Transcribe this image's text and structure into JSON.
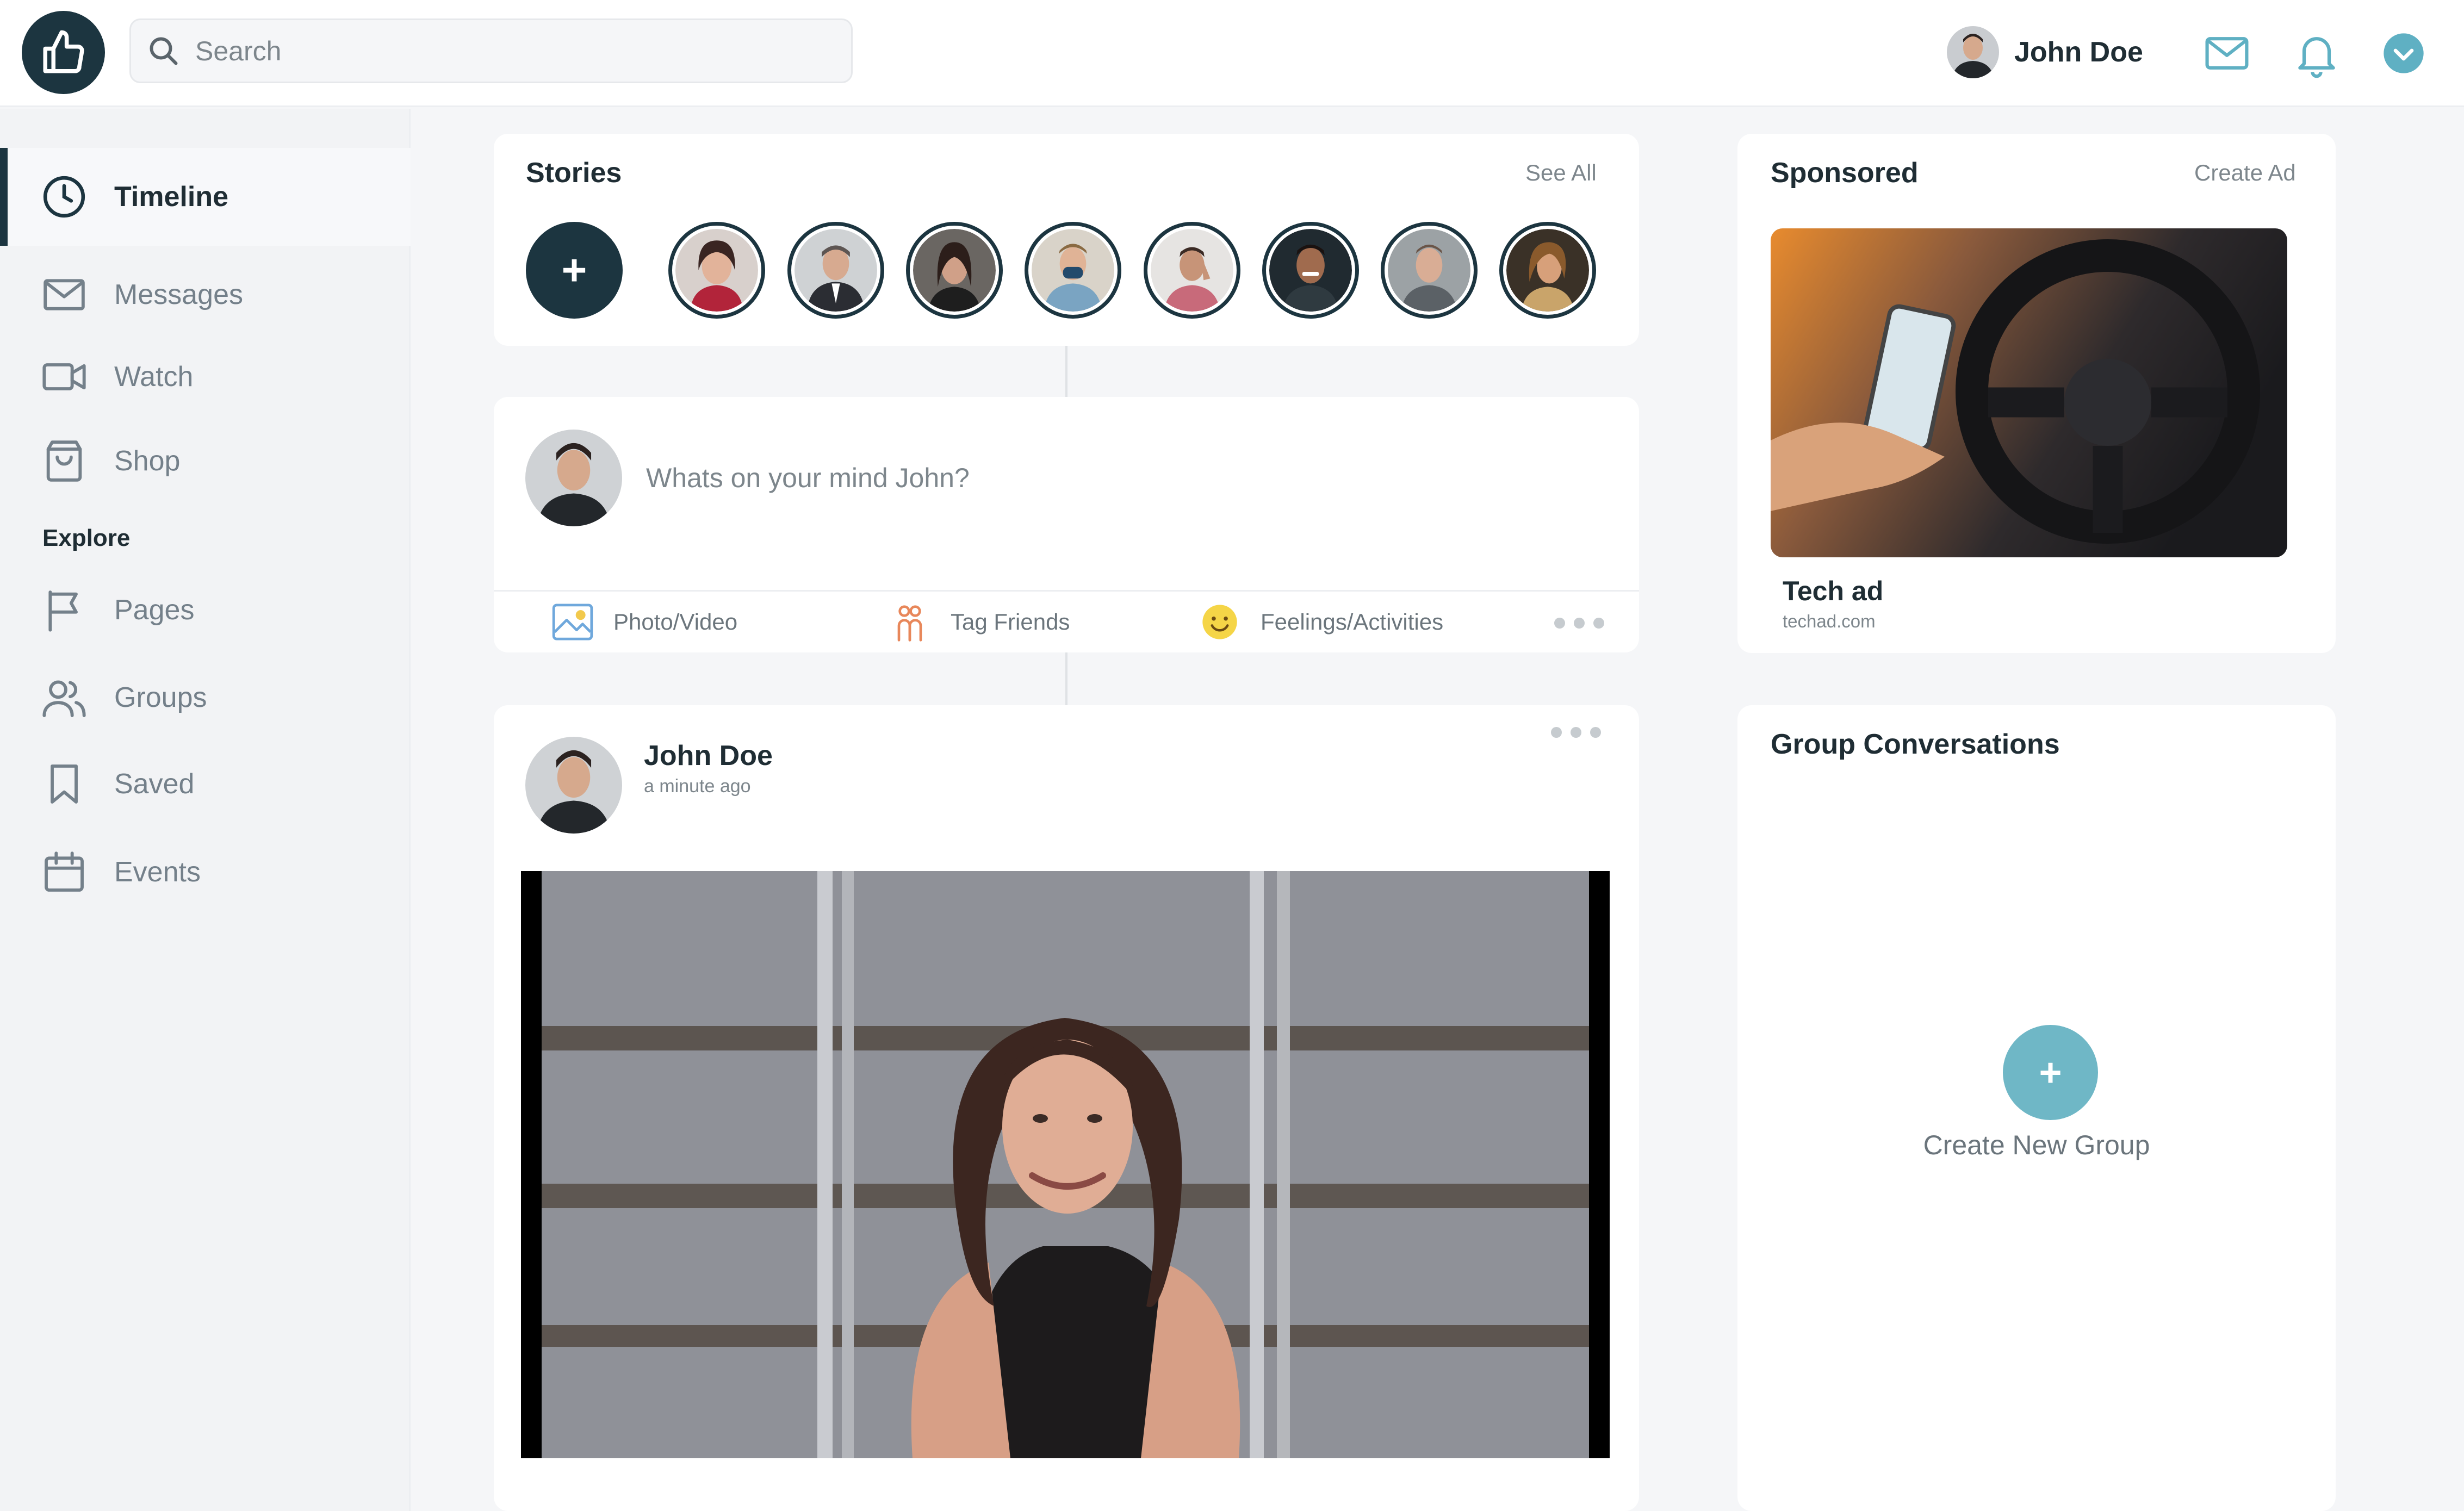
{
  "search": {
    "placeholder": "Search"
  },
  "user": {
    "name": "John Doe"
  },
  "sidebar": {
    "items": [
      {
        "label": "Timeline",
        "icon": "clock-icon",
        "active": true
      },
      {
        "label": "Messages",
        "icon": "mail-icon"
      },
      {
        "label": "Watch",
        "icon": "video-icon"
      },
      {
        "label": "Shop",
        "icon": "shopping-bag-icon"
      }
    ],
    "explore_heading": "Explore",
    "explore_items": [
      {
        "label": "Pages",
        "icon": "flag-icon"
      },
      {
        "label": "Groups",
        "icon": "users-icon"
      },
      {
        "label": "Saved",
        "icon": "bookmark-icon"
      },
      {
        "label": "Events",
        "icon": "calendar-icon"
      }
    ]
  },
  "stories": {
    "title": "Stories",
    "see_all": "See All",
    "add_label": "+"
  },
  "composer": {
    "placeholder": "Whats on your mind John?",
    "actions": [
      {
        "label": "Photo/Video",
        "icon": "image-icon"
      },
      {
        "label": "Tag Friends",
        "icon": "tag-friends-icon"
      },
      {
        "label": "Feelings/Activities",
        "icon": "smiley-icon"
      }
    ]
  },
  "post": {
    "author": "John Doe",
    "time": "a minute ago"
  },
  "sponsored": {
    "title": "Sponsored",
    "create_ad": "Create Ad",
    "ad_name": "Tech ad",
    "ad_url": "techad.com"
  },
  "groups": {
    "title": "Group Conversations",
    "plus": "+",
    "create_label": "Create New Group"
  },
  "colors": {
    "primary_dark": "#1c3540",
    "accent_blue": "#6fb7c6",
    "sidebar_bg": "#f2f3f5"
  }
}
